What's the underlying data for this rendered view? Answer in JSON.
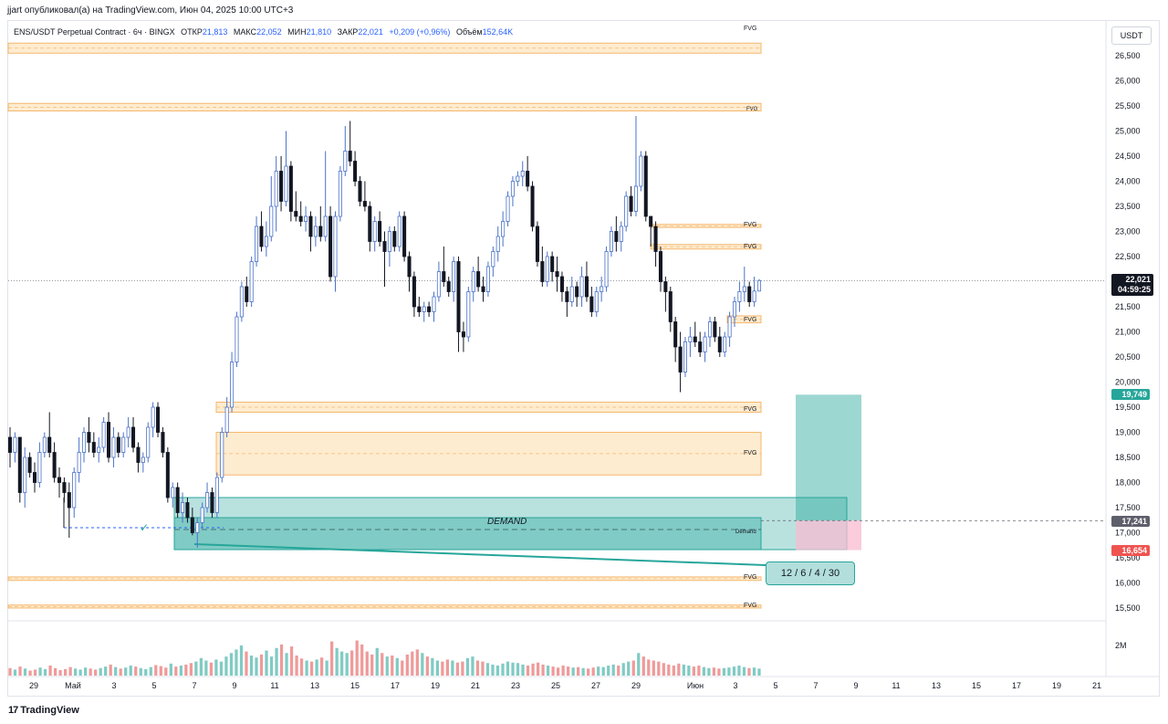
{
  "header": {
    "publisher_line": "jjart опубликовал(а) на TradingView.com, Июн 04, 2025 10:00 UTC+3"
  },
  "legend": {
    "symbol": "ENS/USDT Perpetual Contract · 6ч · BINGX",
    "open_label": "ОТКР",
    "open": "21,813",
    "high_label": "МАКС",
    "high": "22,052",
    "low_label": "МИН",
    "low": "21,810",
    "close_label": "ЗАКР",
    "close": "22,021",
    "change": "+0,209 (+0,96%)",
    "volume_label": "Объём",
    "volume": "152,64K"
  },
  "currency": "USDT",
  "price_tags": {
    "last_price": "22,021",
    "countdown": "04:59:25",
    "target": "19,749",
    "entry": "17,241",
    "stop": "16,654"
  },
  "annotations": {
    "demand": "DEMAND",
    "demand_small": "Demand",
    "fvg": "FVG",
    "risk_label": "12 / 6 / 4 / 30"
  },
  "volume_scale": "2M",
  "footer": {
    "logo_glyph": "17",
    "logo_text": "TradingView"
  },
  "colors": {
    "up_candle": "#4a72c9",
    "down_candle": "#131722",
    "fvg_fill": "#fde5c0",
    "fvg_border": "#f5b76e",
    "demand_fill": "#26a69a",
    "target_zone": "#26a69a",
    "stop_zone": "#f8bbd0",
    "vol_up": "#80cbc4",
    "vol_down": "#ef9a9a"
  },
  "chart_data": {
    "type": "candlestick",
    "timeframe": "6ч",
    "y_ticks": [
      "26,500",
      "26,000",
      "25,500",
      "25,000",
      "24,500",
      "24,000",
      "23,500",
      "23,000",
      "22,500",
      "22,000",
      "21,500",
      "21,000",
      "20,500",
      "20,000",
      "19,500",
      "19,000",
      "18,500",
      "18,000",
      "17,500",
      "17,000",
      "16,500",
      "16,000",
      "15,500"
    ],
    "x_ticks": [
      "29",
      "Май",
      "3",
      "5",
      "7",
      "9",
      "11",
      "13",
      "15",
      "17",
      "19",
      "21",
      "23",
      "25",
      "27",
      "29",
      "Июн",
      "3",
      "5",
      "7",
      "9",
      "11",
      "13",
      "15",
      "17",
      "19",
      "21"
    ],
    "ylim": [
      15200,
      27000
    ],
    "last_price": 22.021,
    "fvg_zones": [
      {
        "low": 26.55,
        "high": 26.75
      },
      {
        "low": 25.4,
        "high": 25.55
      },
      {
        "low": 23.08,
        "high": 23.14
      },
      {
        "low": 22.65,
        "high": 22.74
      },
      {
        "low": 21.18,
        "high": 21.32
      },
      {
        "low": 19.4,
        "high": 19.6
      },
      {
        "low": 18.15,
        "high": 19.0
      },
      {
        "low": 16.05,
        "high": 16.12
      },
      {
        "low": 15.5,
        "high": 15.56
      }
    ],
    "demand_zones": [
      {
        "low": 16.73,
        "high": 17.77
      },
      {
        "low": 16.73,
        "high": 17.3
      }
    ],
    "position": {
      "entry": 17.241,
      "target": 19.749,
      "stop": 16.654
    },
    "candles": [
      [
        18.9,
        19.1,
        18.3,
        18.6
      ],
      [
        18.6,
        19.0,
        18.4,
        18.9
      ],
      [
        18.9,
        18.9,
        17.6,
        17.8
      ],
      [
        17.8,
        18.7,
        17.5,
        18.5
      ],
      [
        18.5,
        18.6,
        18.1,
        18.2
      ],
      [
        18.2,
        18.4,
        17.8,
        18.0
      ],
      [
        18.0,
        18.8,
        17.9,
        18.6
      ],
      [
        18.6,
        19.0,
        18.5,
        18.9
      ],
      [
        18.9,
        19.4,
        18.5,
        18.6
      ],
      [
        18.6,
        18.8,
        18.0,
        18.1
      ],
      [
        18.1,
        18.3,
        17.7,
        18.0
      ],
      [
        18.0,
        18.1,
        17.6,
        17.8
      ],
      [
        17.8,
        18.0,
        16.9,
        17.5
      ],
      [
        17.5,
        18.3,
        17.3,
        18.2
      ],
      [
        18.2,
        18.9,
        18.0,
        18.6
      ],
      [
        18.6,
        19.1,
        18.4,
        19.0
      ],
      [
        19.0,
        19.3,
        18.6,
        18.8
      ],
      [
        18.8,
        19.0,
        18.5,
        18.6
      ],
      [
        18.6,
        18.9,
        18.4,
        18.7
      ],
      [
        18.7,
        19.3,
        18.6,
        19.2
      ],
      [
        19.2,
        19.4,
        18.4,
        18.5
      ],
      [
        18.5,
        19.1,
        18.3,
        18.9
      ],
      [
        18.9,
        19.0,
        18.5,
        18.6
      ],
      [
        18.6,
        19.0,
        18.5,
        18.9
      ],
      [
        18.9,
        19.3,
        18.7,
        19.1
      ],
      [
        19.1,
        19.3,
        18.6,
        18.7
      ],
      [
        18.7,
        18.8,
        18.2,
        18.4
      ],
      [
        18.4,
        18.6,
        18.2,
        18.5
      ],
      [
        18.5,
        19.2,
        18.4,
        19.1
      ],
      [
        19.1,
        19.6,
        18.9,
        19.5
      ],
      [
        19.5,
        19.6,
        18.9,
        19.0
      ],
      [
        19.0,
        19.1,
        18.5,
        18.6
      ],
      [
        18.6,
        18.7,
        17.6,
        17.7
      ],
      [
        17.7,
        18.0,
        17.5,
        17.9
      ],
      [
        17.9,
        18.0,
        17.3,
        17.4
      ],
      [
        17.4,
        17.8,
        17.2,
        17.6
      ],
      [
        17.6,
        17.7,
        17.2,
        17.3
      ],
      [
        17.3,
        17.5,
        16.95,
        17.0
      ],
      [
        17.0,
        17.3,
        16.7,
        17.2
      ],
      [
        17.2,
        17.6,
        17.1,
        17.5
      ],
      [
        17.5,
        18.0,
        17.4,
        17.8
      ],
      [
        17.8,
        17.9,
        17.3,
        17.4
      ],
      [
        17.4,
        18.2,
        17.3,
        18.1
      ],
      [
        18.1,
        19.1,
        18.0,
        19.0
      ],
      [
        19.0,
        19.7,
        18.9,
        19.5
      ],
      [
        19.5,
        20.6,
        19.4,
        20.4
      ],
      [
        20.4,
        21.4,
        20.3,
        21.3
      ],
      [
        21.3,
        22.0,
        21.2,
        21.9
      ],
      [
        21.9,
        22.1,
        21.5,
        21.6
      ],
      [
        21.6,
        22.5,
        21.5,
        22.4
      ],
      [
        22.4,
        23.3,
        22.3,
        23.1
      ],
      [
        23.1,
        23.4,
        22.6,
        22.7
      ],
      [
        22.7,
        23.2,
        22.5,
        22.9
      ],
      [
        22.9,
        24.1,
        22.8,
        23.5
      ],
      [
        23.5,
        24.5,
        23.0,
        24.2
      ],
      [
        24.2,
        24.5,
        23.4,
        23.6
      ],
      [
        23.6,
        25.0,
        23.5,
        24.3
      ],
      [
        24.3,
        24.4,
        23.2,
        23.4
      ],
      [
        23.4,
        23.8,
        23.2,
        23.3
      ],
      [
        23.3,
        23.6,
        23.1,
        23.2
      ],
      [
        23.2,
        23.5,
        23.0,
        23.3
      ],
      [
        23.3,
        23.4,
        22.6,
        22.9
      ],
      [
        22.9,
        23.3,
        22.7,
        23.1
      ],
      [
        23.1,
        23.5,
        22.8,
        22.9
      ],
      [
        22.9,
        24.6,
        22.8,
        23.3
      ],
      [
        23.3,
        23.5,
        22.0,
        22.1
      ],
      [
        22.1,
        23.4,
        21.8,
        23.3
      ],
      [
        23.3,
        24.3,
        23.2,
        24.2
      ],
      [
        24.2,
        25.1,
        24.1,
        24.6
      ],
      [
        24.6,
        25.2,
        24.3,
        24.4
      ],
      [
        24.4,
        24.6,
        23.9,
        24.0
      ],
      [
        24.0,
        24.1,
        23.5,
        23.6
      ],
      [
        23.6,
        24.0,
        23.4,
        23.5
      ],
      [
        23.5,
        23.6,
        22.6,
        22.8
      ],
      [
        22.8,
        23.3,
        22.6,
        23.2
      ],
      [
        23.2,
        23.4,
        22.7,
        22.8
      ],
      [
        22.8,
        23.0,
        21.9,
        22.6
      ],
      [
        22.6,
        23.1,
        22.3,
        23.0
      ],
      [
        23.0,
        23.1,
        22.6,
        22.7
      ],
      [
        22.7,
        23.4,
        22.6,
        23.3
      ],
      [
        23.3,
        23.4,
        22.4,
        22.5
      ],
      [
        22.5,
        22.6,
        21.8,
        22.1
      ],
      [
        22.1,
        22.2,
        21.3,
        21.5
      ],
      [
        21.5,
        21.7,
        21.3,
        21.4
      ],
      [
        21.4,
        21.6,
        21.2,
        21.5
      ],
      [
        21.5,
        21.6,
        21.3,
        21.4
      ],
      [
        21.4,
        21.8,
        21.2,
        21.7
      ],
      [
        21.7,
        22.4,
        21.6,
        22.2
      ],
      [
        22.2,
        22.7,
        21.9,
        22.0
      ],
      [
        22.0,
        22.1,
        21.7,
        21.8
      ],
      [
        21.8,
        22.5,
        21.6,
        22.4
      ],
      [
        22.4,
        22.5,
        20.6,
        21.0
      ],
      [
        21.0,
        21.2,
        20.6,
        20.9
      ],
      [
        20.9,
        21.9,
        20.8,
        21.8
      ],
      [
        21.8,
        22.3,
        21.6,
        22.2
      ],
      [
        22.2,
        22.5,
        21.8,
        21.9
      ],
      [
        21.9,
        22.1,
        21.6,
        21.8
      ],
      [
        21.8,
        22.4,
        21.7,
        22.3
      ],
      [
        22.3,
        22.7,
        22.1,
        22.6
      ],
      [
        22.6,
        23.1,
        22.4,
        22.9
      ],
      [
        22.9,
        23.4,
        22.7,
        23.2
      ],
      [
        23.2,
        23.8,
        23.1,
        23.7
      ],
      [
        23.7,
        24.1,
        23.5,
        24.0
      ],
      [
        24.0,
        24.2,
        23.9,
        24.1
      ],
      [
        24.1,
        24.4,
        23.9,
        24.2
      ],
      [
        24.2,
        24.5,
        23.8,
        23.9
      ],
      [
        23.9,
        24.0,
        23.0,
        23.1
      ],
      [
        23.1,
        23.2,
        22.3,
        22.4
      ],
      [
        22.4,
        22.7,
        21.9,
        22.0
      ],
      [
        22.0,
        22.6,
        21.9,
        22.5
      ],
      [
        22.5,
        22.6,
        22.0,
        22.2
      ],
      [
        22.2,
        22.5,
        21.8,
        22.1
      ],
      [
        22.1,
        22.2,
        21.6,
        21.8
      ],
      [
        21.8,
        21.9,
        21.3,
        21.6
      ],
      [
        21.6,
        22.1,
        21.5,
        21.9
      ],
      [
        21.9,
        22.0,
        21.5,
        21.7
      ],
      [
        21.7,
        22.3,
        21.5,
        22.1
      ],
      [
        22.1,
        22.4,
        21.6,
        21.7
      ],
      [
        21.7,
        21.9,
        21.3,
        21.4
      ],
      [
        21.4,
        21.9,
        21.3,
        21.8
      ],
      [
        21.8,
        22.1,
        21.6,
        21.9
      ],
      [
        21.9,
        22.7,
        21.8,
        22.6
      ],
      [
        22.6,
        23.1,
        22.5,
        23.0
      ],
      [
        23.0,
        23.3,
        22.6,
        22.8
      ],
      [
        22.8,
        23.2,
        22.6,
        23.1
      ],
      [
        23.1,
        23.8,
        23.0,
        23.7
      ],
      [
        23.7,
        23.9,
        23.3,
        23.4
      ],
      [
        23.4,
        25.3,
        23.3,
        23.9
      ],
      [
        23.9,
        24.6,
        23.8,
        24.5
      ],
      [
        24.5,
        24.6,
        23.2,
        23.3
      ],
      [
        23.3,
        23.2,
        22.7,
        23.1
      ],
      [
        23.1,
        23.2,
        22.3,
        22.6
      ],
      [
        22.6,
        22.7,
        21.8,
        22.0
      ],
      [
        22.0,
        22.1,
        21.4,
        21.8
      ],
      [
        21.8,
        21.9,
        21.0,
        21.2
      ],
      [
        21.2,
        21.3,
        20.4,
        20.7
      ],
      [
        20.7,
        21.0,
        19.8,
        20.2
      ],
      [
        20.2,
        20.9,
        20.1,
        20.8
      ],
      [
        20.8,
        21.1,
        20.5,
        20.9
      ],
      [
        20.9,
        21.2,
        20.7,
        20.8
      ],
      [
        20.8,
        21.0,
        20.5,
        20.6
      ],
      [
        20.6,
        21.0,
        20.4,
        20.9
      ],
      [
        20.9,
        21.3,
        20.7,
        21.2
      ],
      [
        21.2,
        21.3,
        20.8,
        20.9
      ],
      [
        20.9,
        21.1,
        20.5,
        20.6
      ],
      [
        20.6,
        21.0,
        20.5,
        20.9
      ],
      [
        20.9,
        21.4,
        20.7,
        21.3
      ],
      [
        21.3,
        21.7,
        21.1,
        21.6
      ],
      [
        21.6,
        22.0,
        21.4,
        21.8
      ],
      [
        21.8,
        22.3,
        21.6,
        21.9
      ],
      [
        21.9,
        22.0,
        21.5,
        21.6
      ],
      [
        21.6,
        22.1,
        21.5,
        21.813
      ],
      [
        21.813,
        22.052,
        21.81,
        22.021
      ]
    ],
    "volumes": [
      0.15,
      0.12,
      0.18,
      0.14,
      0.1,
      0.12,
      0.16,
      0.13,
      0.2,
      0.15,
      0.11,
      0.13,
      0.17,
      0.14,
      0.12,
      0.16,
      0.14,
      0.12,
      0.15,
      0.18,
      0.22,
      0.17,
      0.14,
      0.16,
      0.2,
      0.18,
      0.15,
      0.13,
      0.17,
      0.21,
      0.19,
      0.16,
      0.24,
      0.18,
      0.2,
      0.22,
      0.25,
      0.28,
      0.35,
      0.3,
      0.26,
      0.32,
      0.28,
      0.38,
      0.45,
      0.52,
      0.6,
      0.48,
      0.4,
      0.36,
      0.42,
      0.5,
      0.38,
      0.55,
      0.62,
      0.45,
      0.58,
      0.4,
      0.34,
      0.3,
      0.28,
      0.32,
      0.36,
      0.3,
      0.68,
      0.55,
      0.48,
      0.45,
      0.5,
      0.7,
      0.62,
      0.48,
      0.42,
      0.55,
      0.45,
      0.38,
      0.4,
      0.35,
      0.3,
      0.42,
      0.48,
      0.52,
      0.45,
      0.38,
      0.35,
      0.3,
      0.28,
      0.32,
      0.3,
      0.26,
      0.28,
      0.35,
      0.38,
      0.3,
      0.28,
      0.25,
      0.22,
      0.2,
      0.24,
      0.28,
      0.26,
      0.25,
      0.22,
      0.2,
      0.24,
      0.26,
      0.22,
      0.2,
      0.18,
      0.16,
      0.2,
      0.18,
      0.16,
      0.17,
      0.15,
      0.14,
      0.16,
      0.18,
      0.17,
      0.2,
      0.22,
      0.2,
      0.25,
      0.28,
      0.3,
      0.45,
      0.38,
      0.32,
      0.3,
      0.28,
      0.25,
      0.22,
      0.2,
      0.24,
      0.22,
      0.2,
      0.18,
      0.2,
      0.17,
      0.15,
      0.16,
      0.14,
      0.15,
      0.16,
      0.18,
      0.2,
      0.17,
      0.15,
      0.16,
      0.14
    ]
  }
}
